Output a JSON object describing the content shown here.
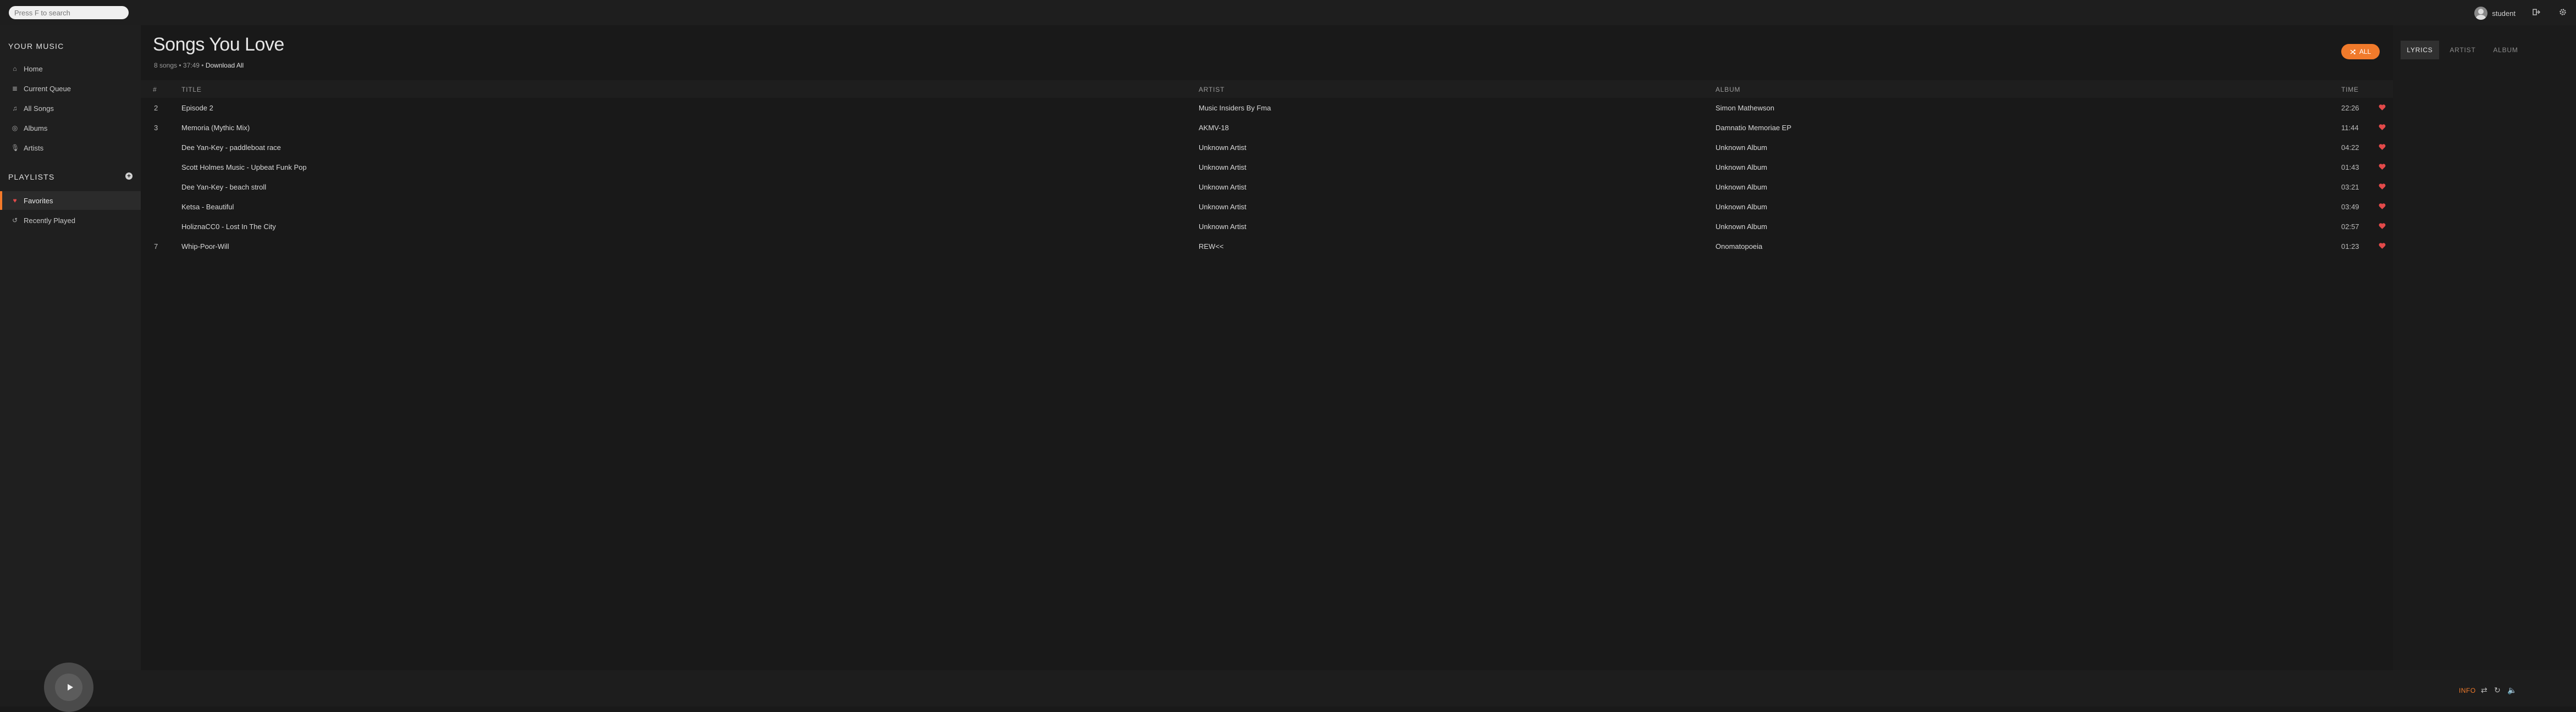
{
  "search": {
    "placeholder": "Press F to search"
  },
  "user": {
    "name": "student"
  },
  "sidebar": {
    "your_music_heading": "YOUR MUSIC",
    "items": [
      {
        "label": "Home",
        "icon": "home-icon"
      },
      {
        "label": "Current Queue",
        "icon": "queue-icon"
      },
      {
        "label": "All Songs",
        "icon": "music-note-icon"
      },
      {
        "label": "Albums",
        "icon": "disc-icon"
      },
      {
        "label": "Artists",
        "icon": "microphone-icon"
      }
    ],
    "playlists_heading": "PLAYLISTS",
    "playlists": [
      {
        "label": "Favorites",
        "icon": "heart-icon",
        "active": true
      },
      {
        "label": "Recently Played",
        "icon": "history-icon",
        "active": false
      }
    ]
  },
  "main": {
    "title": "Songs You Love",
    "meta": "8 songs • 37:49 •",
    "download_label": "Download All",
    "all_button_label": "ALL",
    "columns": {
      "num": "#",
      "title": "TITLE",
      "artist": "ARTIST",
      "album": "ALBUM",
      "time": "TIME"
    },
    "songs": [
      {
        "num": "2",
        "title": "Episode 2",
        "artist": "Music Insiders By Fma",
        "album": "Simon Mathewson",
        "time": "22:26"
      },
      {
        "num": "3",
        "title": "Memoria (Mythic Mix)",
        "artist": "AKMV-18",
        "album": "Damnatio Memoriae EP",
        "time": "11:44"
      },
      {
        "num": "",
        "title": "Dee Yan-Key - paddleboat race",
        "artist": "Unknown Artist",
        "album": "Unknown Album",
        "time": "04:22"
      },
      {
        "num": "",
        "title": "Scott Holmes Music - Upbeat Funk Pop",
        "artist": "Unknown Artist",
        "album": "Unknown Album",
        "time": "01:43"
      },
      {
        "num": "",
        "title": "Dee Yan-Key - beach stroll",
        "artist": "Unknown Artist",
        "album": "Unknown Album",
        "time": "03:21"
      },
      {
        "num": "",
        "title": "Ketsa - Beautiful",
        "artist": "Unknown Artist",
        "album": "Unknown Album",
        "time": "03:49"
      },
      {
        "num": "",
        "title": "HoliznaCC0 - Lost In The City",
        "artist": "Unknown Artist",
        "album": "Unknown Album",
        "time": "02:57"
      },
      {
        "num": "7",
        "title": "Whip-Poor-Will",
        "artist": "REW<<",
        "album": "Onomatopoeia",
        "time": "01:23"
      }
    ]
  },
  "right_panel": {
    "tabs": [
      "LYRICS",
      "ARTIST",
      "ALBUM"
    ],
    "active_tab": "LYRICS"
  },
  "footer": {
    "info_label": "INFO"
  },
  "colors": {
    "accent": "#f07a2b",
    "heart": "#e24a4a",
    "background": "#191919"
  }
}
